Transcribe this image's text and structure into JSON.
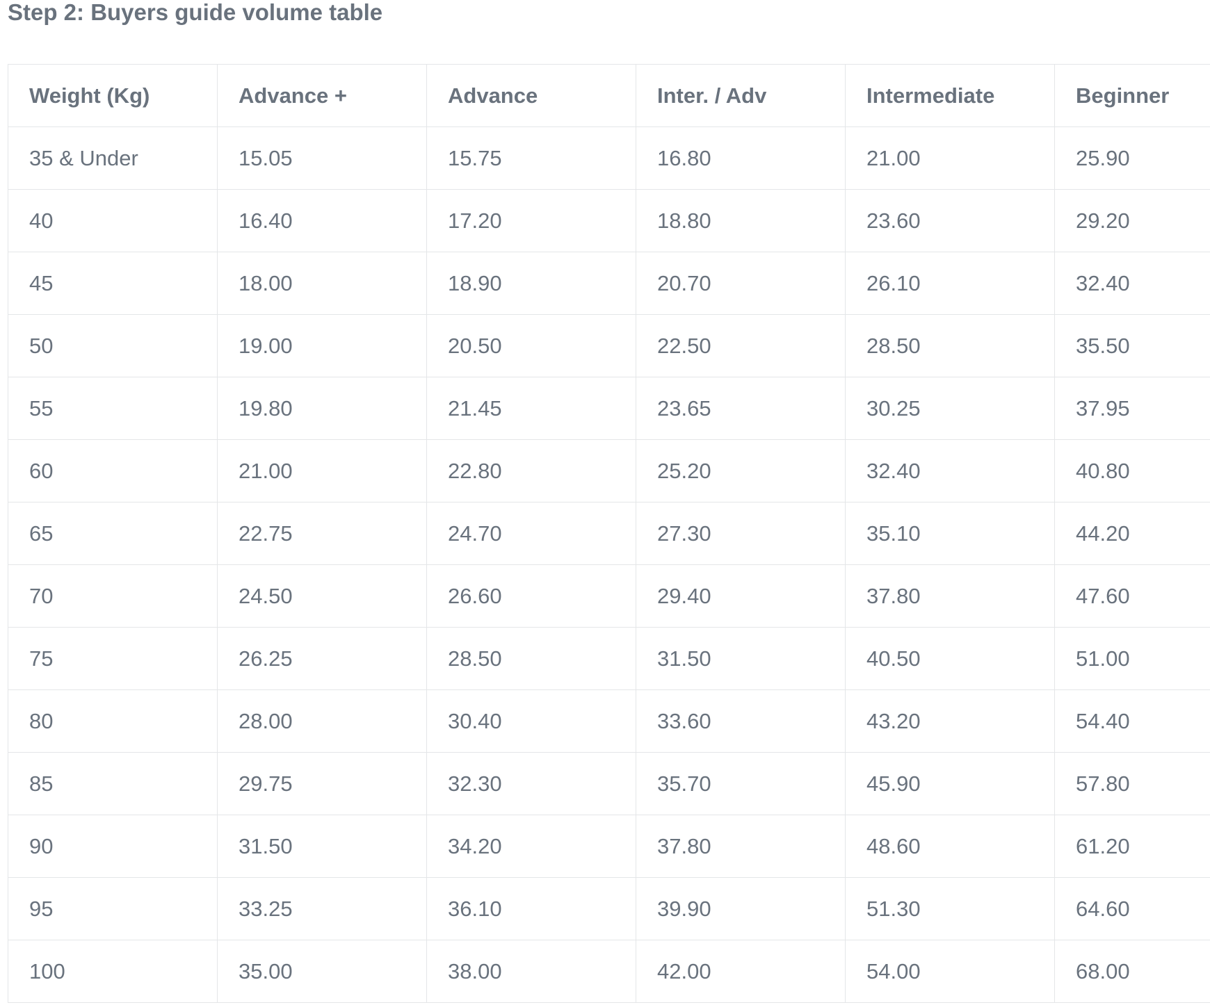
{
  "page": {
    "title": "Step 2: Buyers guide volume table"
  },
  "table": {
    "headers": [
      "Weight (Kg)",
      "Advance +",
      "Advance",
      "Inter. / Adv",
      "Intermediate",
      "Beginner"
    ],
    "rows": [
      [
        "35 & Under",
        "15.05",
        "15.75",
        "16.80",
        "21.00",
        "25.90"
      ],
      [
        "40",
        "16.40",
        "17.20",
        "18.80",
        "23.60",
        "29.20"
      ],
      [
        "45",
        "18.00",
        "18.90",
        "20.70",
        "26.10",
        "32.40"
      ],
      [
        "50",
        "19.00",
        "20.50",
        "22.50",
        "28.50",
        "35.50"
      ],
      [
        "55",
        "19.80",
        "21.45",
        "23.65",
        "30.25",
        "37.95"
      ],
      [
        "60",
        "21.00",
        "22.80",
        "25.20",
        "32.40",
        "40.80"
      ],
      [
        "65",
        "22.75",
        "24.70",
        "27.30",
        "35.10",
        "44.20"
      ],
      [
        "70",
        "24.50",
        "26.60",
        "29.40",
        "37.80",
        "47.60"
      ],
      [
        "75",
        "26.25",
        "28.50",
        "31.50",
        "40.50",
        "51.00"
      ],
      [
        "80",
        "28.00",
        "30.40",
        "33.60",
        "43.20",
        "54.40"
      ],
      [
        "85",
        "29.75",
        "32.30",
        "35.70",
        "45.90",
        "57.80"
      ],
      [
        "90",
        "31.50",
        "34.20",
        "37.80",
        "48.60",
        "61.20"
      ],
      [
        "95",
        "33.25",
        "36.10",
        "39.90",
        "51.30",
        "64.60"
      ],
      [
        "100",
        "35.00",
        "38.00",
        "42.00",
        "54.00",
        "68.00"
      ]
    ]
  },
  "colors": {
    "text": "#69727d",
    "border": "#e4e6e8",
    "background": "#ffffff"
  }
}
